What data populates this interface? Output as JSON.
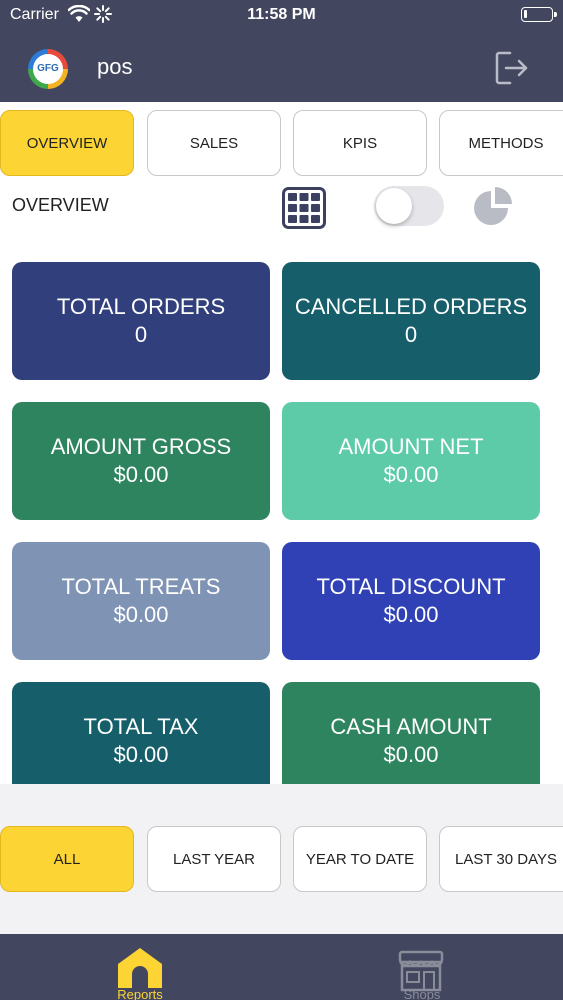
{
  "status_bar": {
    "carrier": "Carrier",
    "time": "11:58 PM"
  },
  "header": {
    "logo_text": "GFG",
    "title": "pos"
  },
  "tabs": [
    {
      "label": "OVERVIEW",
      "active": true
    },
    {
      "label": "SALES",
      "active": false
    },
    {
      "label": "KPIS",
      "active": false
    },
    {
      "label": "METHODS",
      "active": false
    }
  ],
  "section": {
    "title": "OVERVIEW"
  },
  "cards": [
    {
      "label": "TOTAL ORDERS",
      "value": "0",
      "color": "#313f7c"
    },
    {
      "label": "CANCELLED ORDERS",
      "value": "0",
      "color": "#155e6a"
    },
    {
      "label": "AMOUNT GROSS",
      "value": "$0.00",
      "color": "#2f8460"
    },
    {
      "label": "AMOUNT NET",
      "value": "$0.00",
      "color": "#5ecba8"
    },
    {
      "label": "TOTAL TREATS",
      "value": "$0.00",
      "color": "#7f93b5"
    },
    {
      "label": "TOTAL DISCOUNT",
      "value": "$0.00",
      "color": "#3041b5"
    },
    {
      "label": "TOTAL TAX",
      "value": "$0.00",
      "color": "#155e6a"
    },
    {
      "label": "CASH AMOUNT",
      "value": "$0.00",
      "color": "#2f8460"
    }
  ],
  "filters": [
    {
      "label": "ALL",
      "active": true
    },
    {
      "label": "LAST YEAR",
      "active": false
    },
    {
      "label": "YEAR TO DATE",
      "active": false
    },
    {
      "label": "LAST 30 DAYS",
      "active": false
    }
  ],
  "bottom_nav": [
    {
      "label": "Reports",
      "icon": "home-icon",
      "active": true,
      "color": "#fcd535"
    },
    {
      "label": "Shops",
      "icon": "shop-icon",
      "active": false,
      "color": "#8a8c9a"
    }
  ],
  "colors": {
    "accent": "#fcd535",
    "header": "#42465f"
  }
}
